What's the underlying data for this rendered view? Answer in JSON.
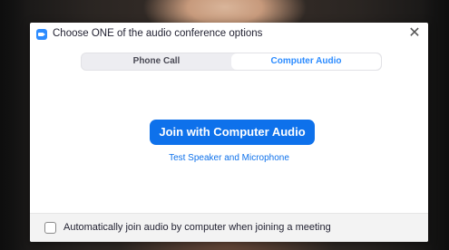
{
  "dialog": {
    "title": "Choose ONE of the audio conference options",
    "app_icon": "zoom-camera-icon",
    "close_icon": "close-icon",
    "close_glyph": "✕"
  },
  "tabs": [
    {
      "label": "Phone Call",
      "active": false
    },
    {
      "label": "Computer Audio",
      "active": true
    }
  ],
  "main": {
    "join_label": "Join with Computer Audio",
    "test_link": "Test Speaker and Microphone"
  },
  "footer": {
    "checkbox_checked": false,
    "label": "Automatically join audio by computer when joining a meeting"
  },
  "colors": {
    "accent": "#0e71eb",
    "active_tab_text": "#2d8cff"
  }
}
